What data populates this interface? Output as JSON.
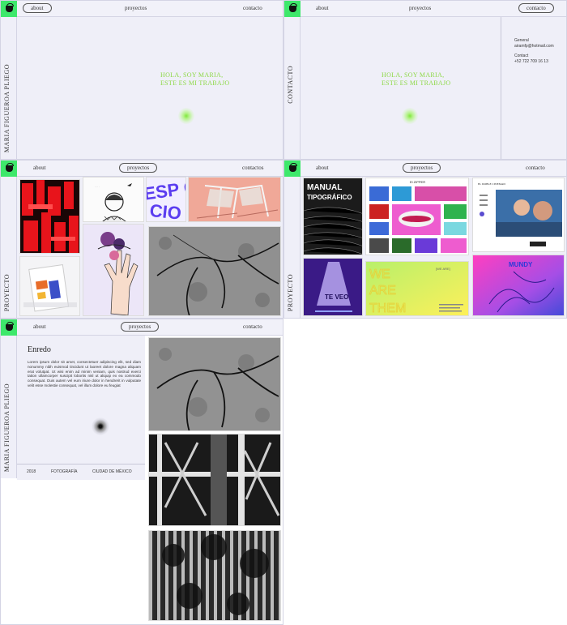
{
  "nav1": {
    "about": "about",
    "projects": "proyectos",
    "contact": "contacto"
  },
  "nav2": {
    "about": "about",
    "projects": "proyectos",
    "contact": "contacto"
  },
  "nav3": {
    "about": "about",
    "projects": "proyectos",
    "contact": "contactos"
  },
  "nav4": {
    "about": "about",
    "projects": "proyectos",
    "contact": "contacto"
  },
  "nav5": {
    "about": "about",
    "projects": "proyectos",
    "contact": "contacto"
  },
  "home": {
    "side": "MARIA FIGUEROA PLIEGO",
    "hero1": "HOLA, SOY MARIA,",
    "hero2": "ESTE ES MI TRABAJO"
  },
  "contact": {
    "side": "CONTACTO",
    "hero1": "HOLA, SOY MARIA,",
    "hero2": "ESTE ES MI TRABAJO",
    "general_label": "General",
    "email": "airamfp@hotmail.com",
    "contact_label": "Contact",
    "phone": "+52 722 709 16 13"
  },
  "projects": {
    "side": "PROYECTO",
    "espacio": "ESP CIO",
    "sub": "Lorem ipsum"
  },
  "projects2": {
    "side": "PROYECTO",
    "manual1": "MANUAL",
    "manual2": "TIPOGRÁFICO",
    "zipper": "El ZIPPER",
    "teveo": "TE VEO",
    "we1": "WE",
    "we2": "ARE",
    "we3": "THEM",
    "cinema": "EL DOBLE CINEMAD",
    "tag": "[WE ARE]"
  },
  "detail": {
    "side": "MARIA FIGUEROA PLIEGO",
    "title": "Enredo",
    "body": "Lorem ipsum dolor sit amet, consectetuer adipiscing elit, sed diam nonummy nibh euismod tincidunt ut laoreet dolore magna aliquam erat volutpat. Ut wisi enim ad minim veniam, quis nostrud exerci tation ullamcorper suscipit lobortis nisl ut aliquip ex ea commodo consequat. Duis autem vel eum iriure dolor in hendrerit in vulputate velit esse molestie consequat, vel illum dolore eu feugiat",
    "year": "2018",
    "category": "FOTOGRAFÍA",
    "city": "CIUDAD DE MÉXICO"
  },
  "colors": {
    "accent": "#3ee86b",
    "hero": "#8fd94a",
    "bg": "#efeff8"
  }
}
